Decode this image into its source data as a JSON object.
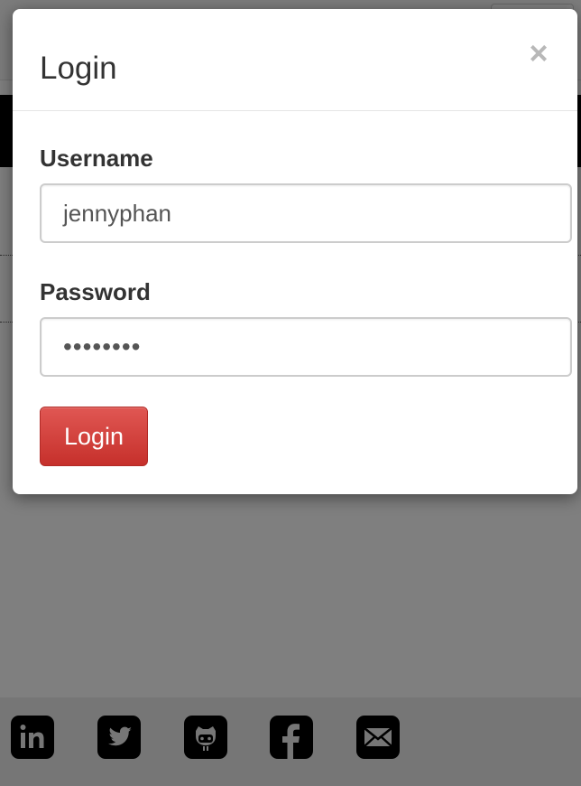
{
  "modal": {
    "title": "Login",
    "close_symbol": "×",
    "username": {
      "label": "Username",
      "value": "jennyphan"
    },
    "password": {
      "label": "Password",
      "masked_value": "••••••••"
    },
    "submit_label": "Login"
  },
  "footer": {
    "social_icons": [
      "linkedin-icon",
      "twitter-icon",
      "github-icon",
      "facebook-icon",
      "mail-icon"
    ]
  },
  "colors": {
    "backdrop": "rgba(0,0,0,0.5)",
    "login_button": "#d43f3a",
    "text": "#333333"
  }
}
